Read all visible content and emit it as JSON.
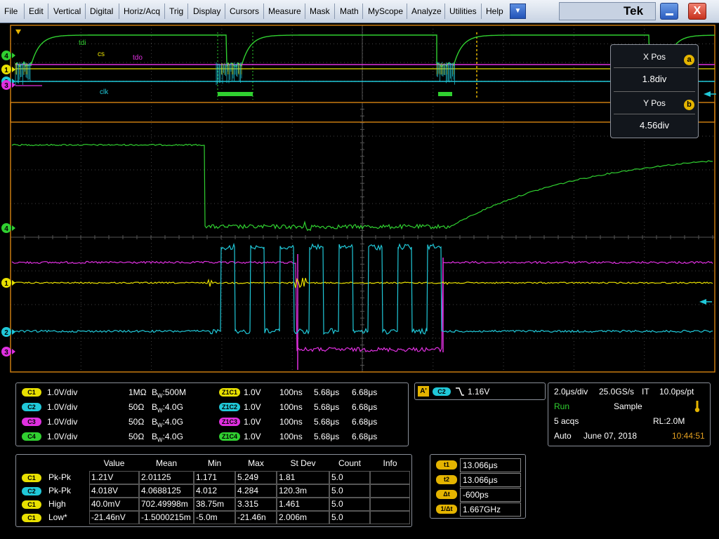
{
  "menubar": {
    "items": [
      "File",
      "Edit",
      "Vertical",
      "Digital",
      "Horiz/Acq",
      "Trig",
      "Display",
      "Cursors",
      "Measure",
      "Mask",
      "Math",
      "MyScope",
      "Analyze",
      "Utilities",
      "Help"
    ],
    "brand": "Tek",
    "dropdown_icon": "chevron-down-icon",
    "minimize_icon": "minimize-icon",
    "close_icon": "close-icon",
    "close_glyph": "X"
  },
  "waveform_labels": {
    "tdi": "tdi",
    "cs": "cs",
    "tdo": "tdo",
    "clk": "clk"
  },
  "channel_markers": {
    "overview": [
      "4",
      "1",
      "2",
      "3"
    ],
    "zoom": [
      "4",
      "1",
      "2",
      "3"
    ]
  },
  "colors": {
    "c1": "#e8e000",
    "c2": "#20c8d8",
    "c3": "#e030e0",
    "c4": "#30d030",
    "grid": "#3a3a3a",
    "frame": "#c87a10",
    "cursor": "#e4b400"
  },
  "xypos": {
    "x_label": "X Pos",
    "x_badge": "a",
    "x_value": "1.8div",
    "y_label": "Y Pos",
    "y_badge": "b",
    "y_value": "4.56div"
  },
  "channels": [
    {
      "badge": "C1",
      "scale": "1.0V/div",
      "imp": "1MΩ",
      "bw": "500M",
      "zoom_badge": "Z1C1",
      "zoom_scale": "1.0V",
      "zoom_time": "100ns",
      "pos1": "5.68μs",
      "pos2": "6.68μs"
    },
    {
      "badge": "C2",
      "scale": "1.0V/div",
      "imp": "50Ω",
      "bw": "4.0G",
      "zoom_badge": "Z1C2",
      "zoom_scale": "1.0V",
      "zoom_time": "100ns",
      "pos1": "5.68μs",
      "pos2": "6.68μs"
    },
    {
      "badge": "C3",
      "scale": "1.0V/div",
      "imp": "50Ω",
      "bw": "4.0G",
      "zoom_badge": "Z1C3",
      "zoom_scale": "1.0V",
      "zoom_time": "100ns",
      "pos1": "5.68μs",
      "pos2": "6.68μs"
    },
    {
      "badge": "C4",
      "scale": "1.0V/div",
      "imp": "50Ω",
      "bw": "4.0G",
      "zoom_badge": "Z1C4",
      "zoom_scale": "1.0V",
      "zoom_time": "100ns",
      "pos1": "5.68μs",
      "pos2": "6.68μs"
    }
  ],
  "bw_prefix": "B",
  "bw_sub": "W",
  "bw_sep": ":",
  "trigger": {
    "mode": "A'",
    "source": "C2",
    "slope": "falling",
    "level": "1.16V"
  },
  "acq": {
    "timebase": "2.0μs/div",
    "sample_rate": "25.0GS/s",
    "mode_it": "IT",
    "resolution": "10.0ps/pt",
    "state": "Run",
    "mode": "Sample",
    "acqs": "5 acqs",
    "rl": "RL:2.0M",
    "trigger_mode": "Auto",
    "date": "June 07, 2018",
    "time": "10:44:51"
  },
  "measurements": {
    "headers": [
      "Value",
      "Mean",
      "Min",
      "Max",
      "St Dev",
      "Count",
      "Info"
    ],
    "rows": [
      {
        "badge": "C1",
        "name": "Pk-Pk",
        "value": "1.21V",
        "mean": "2.01125",
        "min": "1.171",
        "max": "5.249",
        "stdev": "1.81",
        "count": "5.0",
        "info": ""
      },
      {
        "badge": "C2",
        "name": "Pk-Pk",
        "value": "4.018V",
        "mean": "4.0688125",
        "min": "4.012",
        "max": "4.284",
        "stdev": "120.3m",
        "count": "5.0",
        "info": ""
      },
      {
        "badge": "C1",
        "name": "High",
        "value": "40.0mV",
        "mean": "702.49998m",
        "min": "38.75m",
        "max": "3.315",
        "stdev": "1.461",
        "count": "5.0",
        "info": ""
      },
      {
        "badge": "C1",
        "name": "Low*",
        "value": "-21.46nV",
        "mean": "-1.5000215m",
        "min": "-5.0m",
        "max": "-21.46n",
        "stdev": "2.006m",
        "count": "5.0",
        "info": ""
      }
    ]
  },
  "cursors": [
    {
      "badge": "t1",
      "value": "13.066μs"
    },
    {
      "badge": "t2",
      "value": "13.066μs"
    },
    {
      "badge": "Δt",
      "value": "-600ps"
    },
    {
      "badge": "1/Δt",
      "value": "1.667GHz"
    }
  ]
}
